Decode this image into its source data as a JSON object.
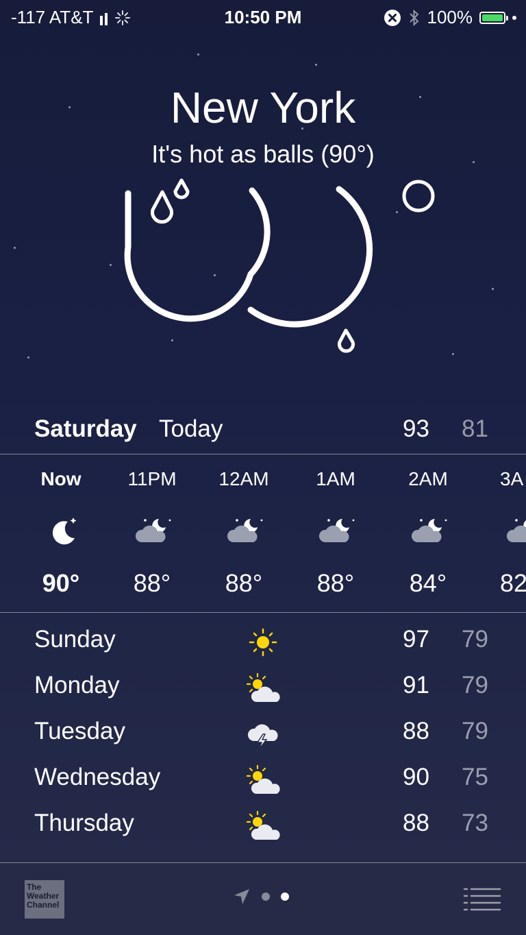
{
  "status_bar": {
    "carrier": "-117 AT&T",
    "time": "10:50 PM",
    "battery": "100%",
    "battery_level": 1.0,
    "battery_color": "#4cd964"
  },
  "header": {
    "city": "New York",
    "condition": "It's hot as balls (90°)",
    "icon": "rain-moon-icon"
  },
  "today": {
    "day": "Saturday",
    "label": "Today",
    "high": "93",
    "low": "81"
  },
  "hourly": [
    {
      "time": "Now",
      "icon": "moon-icon",
      "temp": "90°"
    },
    {
      "time": "11PM",
      "icon": "cloud-moon-icon",
      "temp": "88°"
    },
    {
      "time": "12AM",
      "icon": "cloud-moon-icon",
      "temp": "88°"
    },
    {
      "time": "1AM",
      "icon": "cloud-moon-icon",
      "temp": "88°"
    },
    {
      "time": "2AM",
      "icon": "cloud-moon-icon",
      "temp": "84°"
    },
    {
      "time": "3A",
      "icon": "cloud-moon-icon",
      "temp": "82"
    }
  ],
  "daily": [
    {
      "day": "Sunday",
      "icon": "sun-icon",
      "high": "97",
      "low": "79"
    },
    {
      "day": "Monday",
      "icon": "partly-cloudy-icon",
      "high": "91",
      "low": "79"
    },
    {
      "day": "Tuesday",
      "icon": "thunderstorm-icon",
      "high": "88",
      "low": "79"
    },
    {
      "day": "Wednesday",
      "icon": "partly-cloudy-icon",
      "high": "90",
      "low": "75"
    },
    {
      "day": "Thursday",
      "icon": "partly-cloudy-icon",
      "high": "88",
      "low": "73"
    }
  ],
  "bottom_bar": {
    "logo_text": "The Weather Channel",
    "page_count": 2,
    "current_page": 2
  },
  "colors": {
    "background_top": "#161c3a",
    "sun": "#ffd60a",
    "cloud": "#9aa0b0"
  }
}
